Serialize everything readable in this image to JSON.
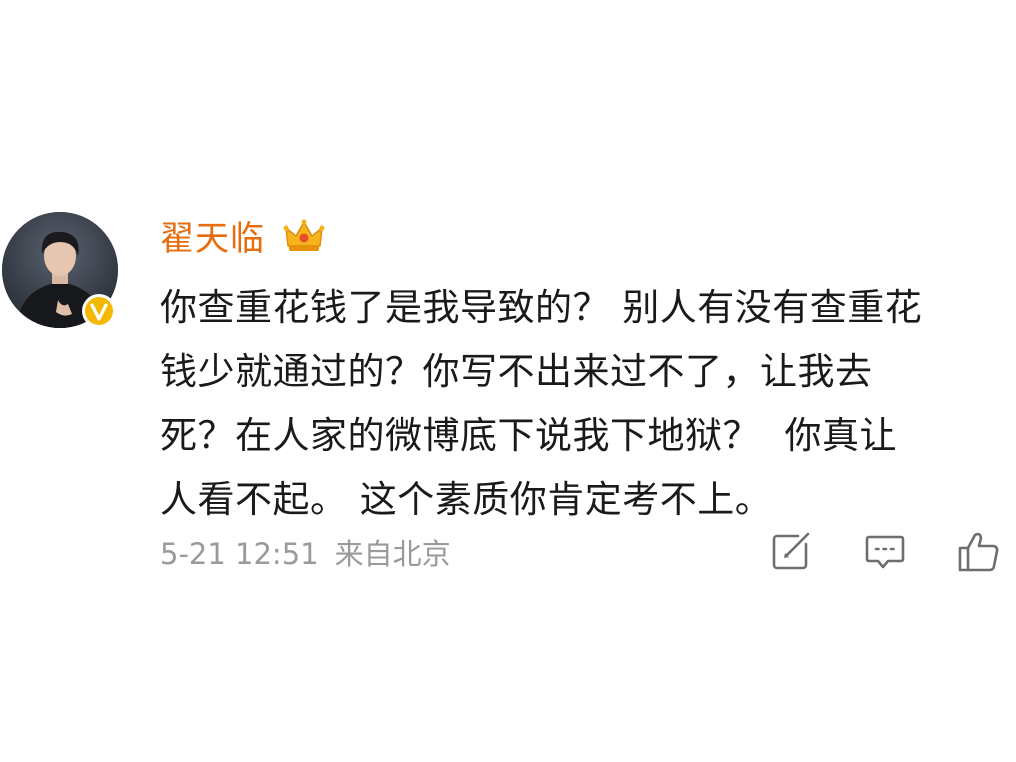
{
  "post": {
    "username": "翟天临",
    "comment_lines": [
      "你查重花钱了是我导致的？ 别人有没有查重花",
      "钱少就通过的？你写不出来过不了，让我去",
      "死？在人家的微博底下说我下地狱？  你真让",
      "人看不起。 这个素质你肯定考不上。"
    ],
    "date": "5-21 12:51",
    "source": "来自北京"
  },
  "icons": {
    "avatar": "user-avatar-photo",
    "verified": "verified-v-badge-icon",
    "crown": "crown-vip-icon",
    "share": "repost-icon",
    "comment": "comment-icon",
    "like": "thumbs-up-icon"
  },
  "colors": {
    "username": "#e86c0b",
    "text": "#1a1a1a",
    "meta": "#9a9a9a",
    "verified": "#f5b800",
    "icon": "#6e6e6e"
  }
}
